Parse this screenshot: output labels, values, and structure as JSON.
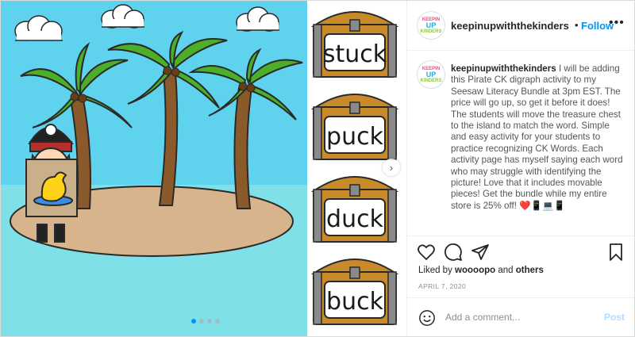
{
  "post": {
    "username": "keepinupwiththekinders",
    "separator": "•",
    "follow_label": "Follow",
    "more_glyph": "•••",
    "avatar_text": [
      "KEEPIN",
      "UP",
      "KINDERS"
    ],
    "caption": "I will be adding this Pirate CK digraph activity to my Seesaw Literacy Bundle at 3pm EST. The price will go up, so get it before it does! The students will move the treasure chest to the island to match the word. Simple and easy activity for your students to practice recognizing CK Words. Each activity page has myself saying each word who may struggle with identifying the picture! Love that it includes movable pieces! Get the bundle while my entire store is 25% off! ❤️📱💻📱",
    "liked_prefix": "Liked by",
    "liked_user": "woooopo",
    "liked_and": "and",
    "liked_others": "others",
    "date": "APRIL 7, 2020",
    "comment_placeholder": "Add a comment...",
    "post_label": "Post"
  },
  "media": {
    "words": [
      "stuck",
      "puck",
      "duck",
      "buck"
    ],
    "carousel_count": 4,
    "carousel_active": 0,
    "next_glyph": "›"
  },
  "colors": {
    "sky": "#5fd3ee",
    "sea": "#7fe0e8",
    "sand": "#d8b48c",
    "accent": "#0095f6",
    "chest_wood": "#c98a2a",
    "chest_band": "#8a8a8a"
  },
  "icons": [
    "heart-icon",
    "comment-icon",
    "share-icon",
    "bookmark-icon",
    "emoji-icon",
    "chevron-right-icon",
    "more-icon"
  ]
}
